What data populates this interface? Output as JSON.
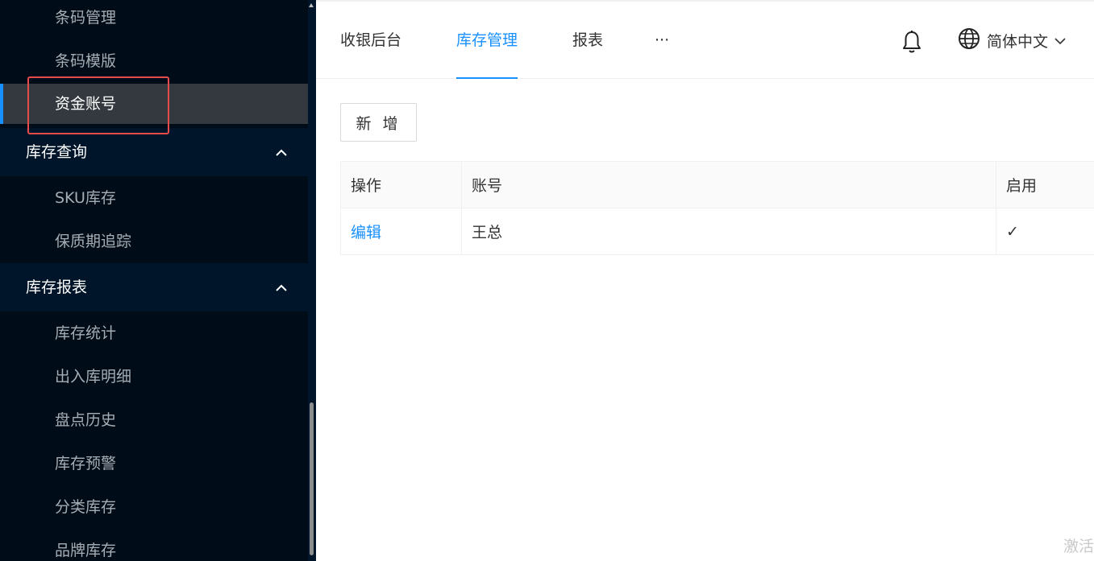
{
  "sidebar": {
    "group_top": {
      "items": [
        "条码管理",
        "条码模版",
        "资金账号"
      ]
    },
    "groups": [
      {
        "title": "库存查询",
        "items": [
          "SKU库存",
          "保质期追踪"
        ]
      },
      {
        "title": "库存报表",
        "items": [
          "库存统计",
          "出入库明细",
          "盘点历史",
          "库存预警",
          "分类库存",
          "品牌库存"
        ]
      }
    ]
  },
  "header": {
    "tabs": [
      "收银后台",
      "库存管理",
      "报表"
    ],
    "more": "···",
    "language": "简体中文"
  },
  "content": {
    "add_label": "新 增",
    "table": {
      "columns": [
        "操作",
        "账号",
        "启用"
      ],
      "rows": [
        {
          "action": "编辑",
          "account": "王总",
          "enabled": "✓"
        }
      ]
    }
  },
  "watermark": "激活"
}
